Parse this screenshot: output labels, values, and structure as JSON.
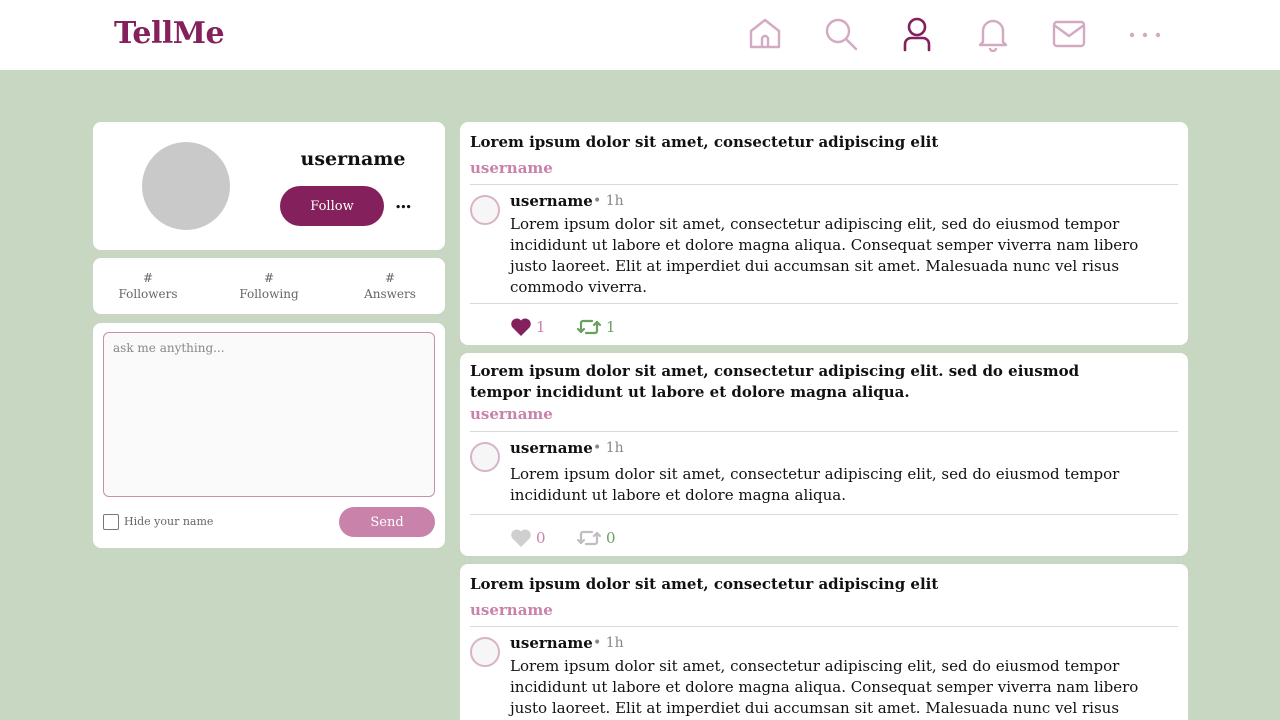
{
  "app": {
    "logo": "TellMe"
  },
  "nav": [
    {
      "name": "home-icon",
      "active": false
    },
    {
      "name": "search-icon",
      "active": false
    },
    {
      "name": "profile-icon",
      "active": true
    },
    {
      "name": "bell-icon",
      "active": false
    },
    {
      "name": "mail-icon",
      "active": false
    },
    {
      "name": "more-icon",
      "active": false
    }
  ],
  "colors": {
    "brand": "#84205b",
    "accent": "#c983aa",
    "background": "#c7d7c1",
    "retweet": "#6aa05e",
    "inactive": "#d4a9c2"
  },
  "profile": {
    "username": "username",
    "follow_label": "Follow",
    "more_label": "..."
  },
  "stats": [
    {
      "num": "#",
      "label": "Followers"
    },
    {
      "num": "#",
      "label": "Following"
    },
    {
      "num": "#",
      "label": "Answers"
    }
  ],
  "ask": {
    "placeholder": "ask me anything...",
    "hide_label": "Hide your name",
    "send_label": "Send"
  },
  "posts": [
    {
      "question": "Lorem ipsum dolor sit amet, consectetur adipiscing elit",
      "asker": "username",
      "answerer": "username",
      "time": "• 1h",
      "answer": "Lorem ipsum dolor sit amet, consectetur adipiscing elit, sed do eiusmod tempor incididunt ut labore et dolore magna aliqua. Consequat semper viverra nam libero justo laoreet. Elit at imperdiet dui accumsan sit amet. Malesuada nunc vel risus commodo viverra.",
      "likes": "1",
      "liked": true,
      "retweets": "1",
      "retweeted": true
    },
    {
      "question": "Lorem ipsum dolor sit amet, consectetur adipiscing elit.  sed do eiusmod tempor incididunt ut labore et dolore magna aliqua.",
      "asker": "username",
      "answerer": "username",
      "time": "• 1h",
      "answer": "Lorem ipsum dolor sit amet, consectetur adipiscing elit, sed do eiusmod tempor incididunt ut labore et dolore magna aliqua.",
      "likes": "0",
      "liked": false,
      "retweets": "0",
      "retweeted": false
    },
    {
      "question": "Lorem ipsum dolor sit amet, consectetur adipiscing elit",
      "asker": "username",
      "answerer": "username",
      "time": "• 1h",
      "answer": "Lorem ipsum dolor sit amet, consectetur adipiscing elit, sed do eiusmod tempor incididunt ut labore et dolore magna aliqua. Consequat semper viverra nam libero justo laoreet. Elit at imperdiet dui accumsan sit amet. Malesuada nunc vel risus commodo viverra.",
      "likes": "",
      "liked": false,
      "retweets": "",
      "retweeted": false
    }
  ]
}
